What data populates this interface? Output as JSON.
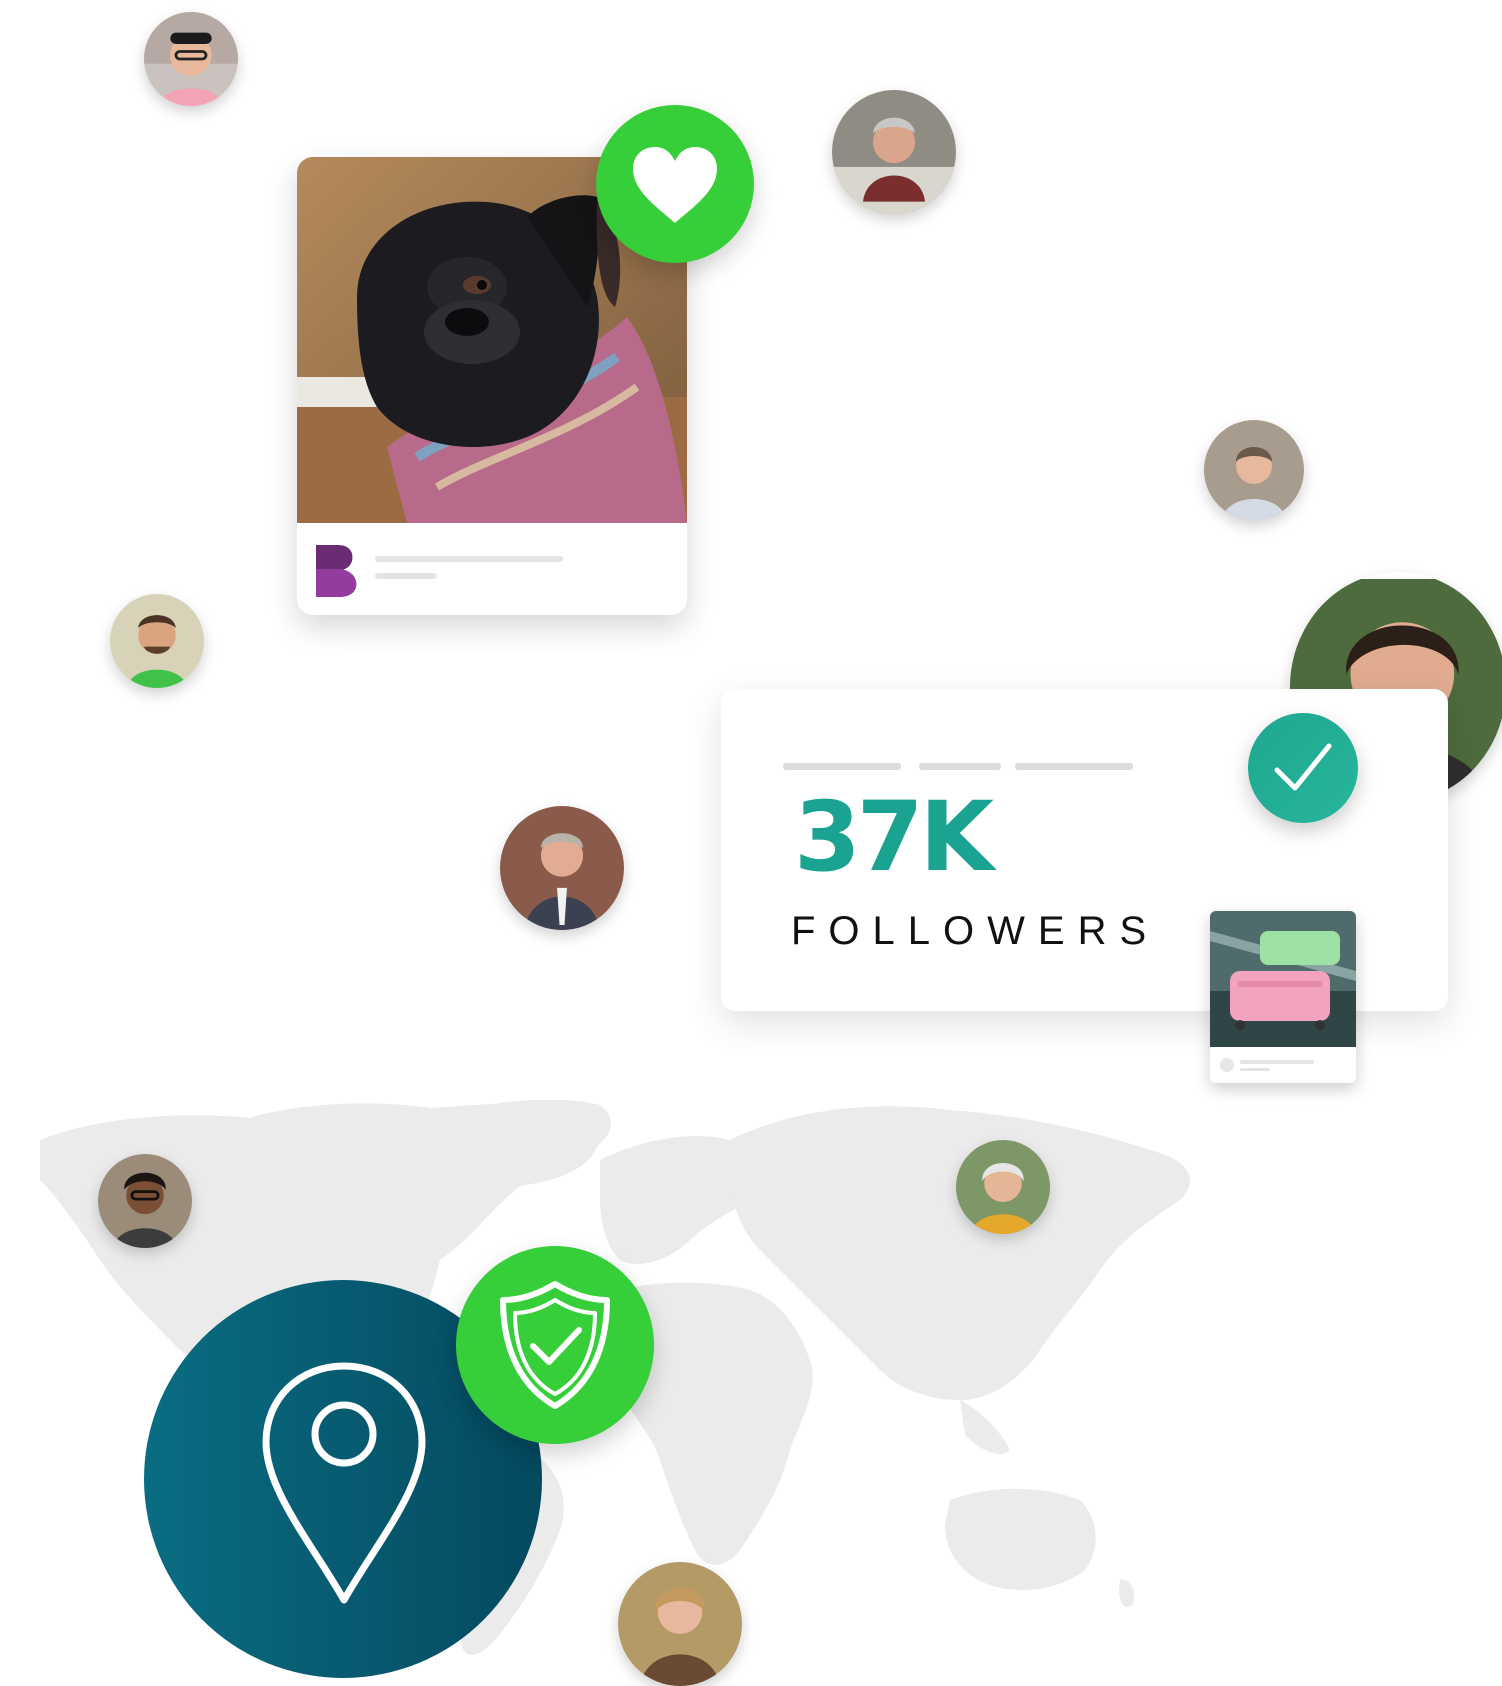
{
  "stats": {
    "count": "37K",
    "label": "FOLLOWERS"
  },
  "colors": {
    "accent_green": "#36cf3a",
    "teal": "#1aa391",
    "location_dark": "#04495f",
    "map_gray": "#ebebeb"
  },
  "icons": {
    "like": "heart-icon",
    "verified": "checkmark-icon",
    "security": "shield-check-icon",
    "location": "map-pin-icon",
    "brand": "brand-logo-icon"
  }
}
